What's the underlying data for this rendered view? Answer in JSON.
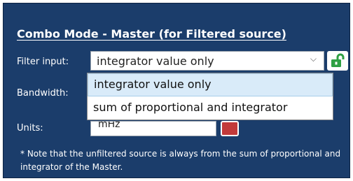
{
  "panel": {
    "title": "Combo Mode - Master (for Filtered source)"
  },
  "filter_input": {
    "label": "Filter input:",
    "value": "integrator value only",
    "dropdown_options": [
      "integrator value only",
      "sum of proportional and integrator"
    ],
    "selected_index": 0
  },
  "bandwidth": {
    "label": "Bandwidth:"
  },
  "units": {
    "label": "Units:",
    "value": "mHz"
  },
  "note": "* Note that the unfiltered source is always from the sum of proportional and integrator of the Master.",
  "icons": {
    "lock": "unlock-icon",
    "chevron": "chevron-down-icon"
  },
  "colors": {
    "panel_bg": "#1b3d6b",
    "lock_green": "#2ea043",
    "dropdown_highlight": "#d9ebf9",
    "units_button_red": "#c23a3a"
  }
}
